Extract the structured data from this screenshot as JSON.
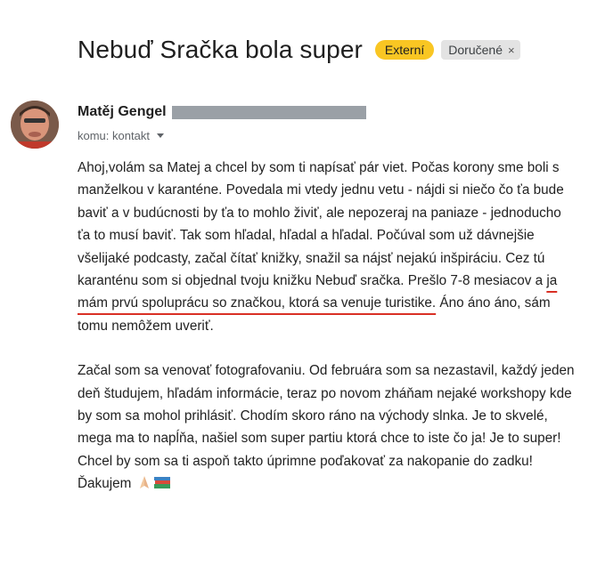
{
  "subject": "Nebuď Sračka bola super",
  "labels": {
    "external": "Externí",
    "inbox": "Doručené",
    "remove": "×"
  },
  "sender": {
    "name": "Matěj Gengel"
  },
  "recipient": "komu: kontakt",
  "message": {
    "p1_before": "Ahoj,volám sa Matej a chcel by som ti napísať pár viet. Počas korony sme boli s manželkou v karanténe. Povedala mi vtedy jednu vetu - nájdi si niečo čo ťa bude baviť a v budúcnosti by ťa to mohlo živiť, ale nepozeraj na paniaze - jednoducho ťa to musí baviť. Tak som hľadal, hľadal a hľadal. Počúval som už dávnejšie všelijaké podcasty, začal čítať knižky, snažil sa nájsť nejakú inšpiráciu. Cez tú karanténu som si objednal tvoju knižku Nebuď sračka. Prešlo 7-8 mesiacov a ",
    "p1_highlight": "ja mám prvú spoluprácu so značkou, ktorá sa venuje turistike.",
    "p1_after": " Áno áno áno, sám tomu nemôžem uveriť.",
    "p2": "Začal som sa venovať fotografovaniu. Od februára som sa nezastavil, každý jeden deň študujem, hľadám informácie, teraz po novom zháňam nejaké workshopy kde by som sa mohol prihlásiť. Chodím skoro ráno na východy slnka. Je to skvelé, mega ma to napĺňa, našiel som super partiu ktorá chce to iste čo ja! Je to super! Chcel by som sa ti aspoň takto úprimne poďakovať za nakopanie do zadku!  Ďakujem"
  },
  "icons": [
    "praying-hands-icon",
    "books-icon"
  ],
  "colors": {
    "external_chip": "#f9c623",
    "inbox_chip": "#e3e3e3",
    "underline": "#d93025"
  }
}
